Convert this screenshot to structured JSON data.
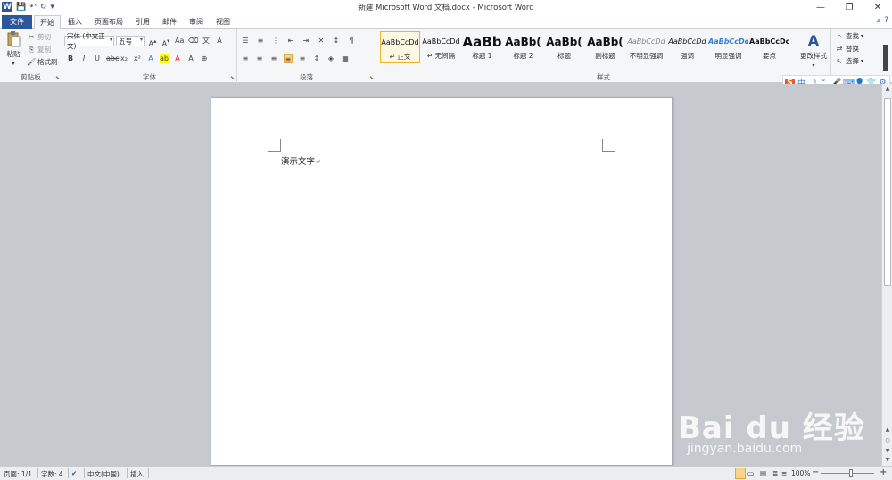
{
  "window": {
    "title": "新建 Microsoft Word 文档.docx - Microsoft Word",
    "controls": {
      "minimize": "—",
      "restore": "❐",
      "close": "✕"
    }
  },
  "quick_access": {
    "logo": "W",
    "save": "💾",
    "undo": "↶",
    "redo": "↻",
    "customize": "▾"
  },
  "tabs": [
    "文件",
    "开始",
    "插入",
    "页面布局",
    "引用",
    "邮件",
    "审阅",
    "视图"
  ],
  "ribbon": {
    "clipboard": {
      "paste": "粘贴",
      "cut": "剪切",
      "copy": "复制",
      "format_painter": "格式刷",
      "label": "剪贴板"
    },
    "font": {
      "font_name": "宋体 (中文正文)",
      "font_size": "五号",
      "label": "字体"
    },
    "paragraph": {
      "label": "段落"
    },
    "styles": {
      "items": [
        {
          "sample": "AaBbCcDd",
          "label": "↵ 正文"
        },
        {
          "sample": "AaBbCcDd",
          "label": "↵ 无间隔"
        },
        {
          "sample": "AaBb",
          "label": "标题 1"
        },
        {
          "sample": "AaBb(",
          "label": "标题 2"
        },
        {
          "sample": "AaBb(",
          "label": "标题"
        },
        {
          "sample": "AaBb(",
          "label": "副标题"
        },
        {
          "sample": "AaBbCcDd",
          "label": "不明显强调"
        },
        {
          "sample": "AaBbCcDd",
          "label": "强调"
        },
        {
          "sample": "AaBbCcDd",
          "label": "明显强调"
        },
        {
          "sample": "AaBbCcDc",
          "label": "要点"
        }
      ],
      "change_styles": "更改样式",
      "label": "样式"
    },
    "editing": {
      "find": "查找",
      "replace": "替换",
      "select": "选择"
    }
  },
  "ime": {
    "brand": "S",
    "mode": "中",
    "items": [
      "☽",
      "°,",
      "🎤",
      "⌨",
      "👤",
      "👕",
      "⚙"
    ]
  },
  "document": {
    "text": "演示文字",
    "mark": "↵"
  },
  "status": {
    "page": "页面: 1/1",
    "words": "字数: 4",
    "language": "中文(中国)",
    "mode": "插入",
    "zoom": "100%",
    "zoom_minus": "−",
    "zoom_plus": "+"
  },
  "watermark": {
    "logo": "Bai du 经验",
    "url": "jingyan.baidu.com"
  },
  "colors": {
    "accent": "#2b579a",
    "highlight": "#ffff00",
    "font_color": "#e81123",
    "selected_style": "#f0b42c"
  }
}
